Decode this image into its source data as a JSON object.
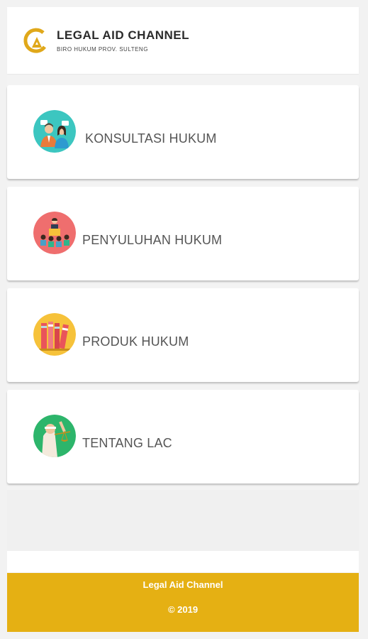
{
  "header": {
    "title": "LEGAL AID CHANNEL",
    "subtitle": "BIRO HUKUM PROV. SULTENG",
    "logo_icon": "triangle-c-logo-icon"
  },
  "menu": [
    {
      "label": "KONSULTASI HUKUM",
      "icon": "consultation-icon",
      "color": "#3cc6c0"
    },
    {
      "label": "PENYULUHAN HUKUM",
      "icon": "counseling-icon",
      "color": "#ef6e6e"
    },
    {
      "label": "PRODUK HUKUM",
      "icon": "books-icon",
      "color": "#f6c23a"
    },
    {
      "label": "TENTANG LAC",
      "icon": "justice-icon",
      "color": "#2db56b"
    }
  ],
  "footer": {
    "name": "Legal Aid Channel",
    "copyright": "© 2019"
  },
  "colors": {
    "accent": "#e5b013",
    "text": "#555555"
  }
}
